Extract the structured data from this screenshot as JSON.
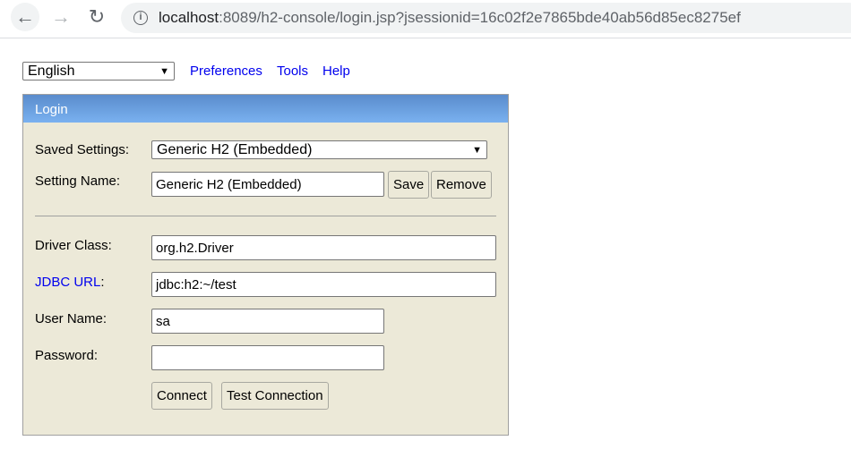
{
  "browser": {
    "url_host": "localhost",
    "url_rest": ":8089/h2-console/login.jsp?jsessionid=16c02f2e7865bde40ab56d85ec8275ef"
  },
  "topbar": {
    "language": "English",
    "links": [
      "Preferences",
      "Tools",
      "Help"
    ]
  },
  "login": {
    "title": "Login",
    "saved_settings_label": "Saved Settings:",
    "saved_settings_value": "Generic H2 (Embedded)",
    "setting_name_label": "Setting Name:",
    "setting_name_value": "Generic H2 (Embedded)",
    "save": "Save",
    "remove": "Remove",
    "driver_label": "Driver Class:",
    "driver_value": "org.h2.Driver",
    "jdbc_label": "JDBC URL",
    "jdbc_value": "jdbc:h2:~/test",
    "user_label": "User Name:",
    "user_value": "sa",
    "password_label": "Password:",
    "password_value": "",
    "connect": "Connect",
    "test": "Test Connection"
  },
  "colors": {
    "header_top": "#5a8ccc",
    "header_bottom": "#7ab1f0",
    "panel_bg": "#ece9d8",
    "link": "#0000ee"
  }
}
